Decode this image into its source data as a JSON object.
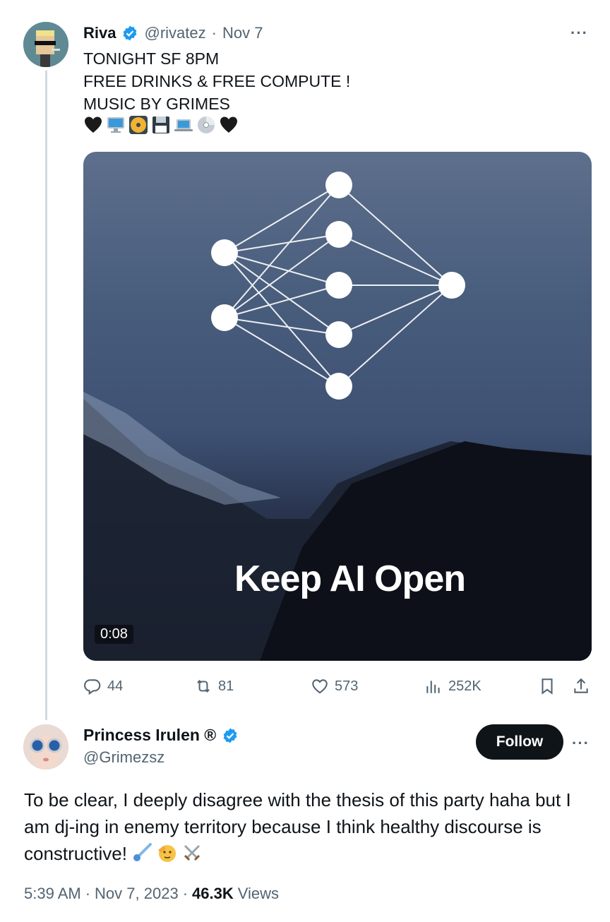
{
  "tweet": {
    "author_name": "Riva",
    "handle": "@rivatez",
    "separator": "·",
    "date": "Nov 7",
    "text_lines": [
      "TONIGHT SF 8PM",
      "FREE DRINKS & FREE COMPUTE !",
      "MUSIC BY GRIMES"
    ],
    "emojis": [
      "black-heart",
      "desktop-computer",
      "dvd",
      "floppy-disk",
      "laptop",
      "cd",
      "black-heart"
    ],
    "media": {
      "overlay_text": "Keep AI Open",
      "duration": "0:08"
    },
    "actions": {
      "replies": "44",
      "reposts": "81",
      "likes": "573",
      "views": "252K"
    }
  },
  "reply": {
    "author_name": "Princess Irulen ®",
    "handle": "@Grimezsz",
    "follow_label": "Follow",
    "text": "To be clear, I deeply disagree with the thesis of this party haha but I am dj-ing in enemy territory because I think healthy discourse is constructive!",
    "emojis": [
      "comet",
      "saluting-face",
      "crossed-swords"
    ],
    "time": "5:39 AM",
    "separator": "·",
    "date": "Nov 7, 2023",
    "views_count": "46.3K",
    "views_label": "Views"
  },
  "colors": {
    "verified_blue": "#1d9bf0",
    "muted_text": "#536471",
    "follow_bg": "#0f1419"
  }
}
